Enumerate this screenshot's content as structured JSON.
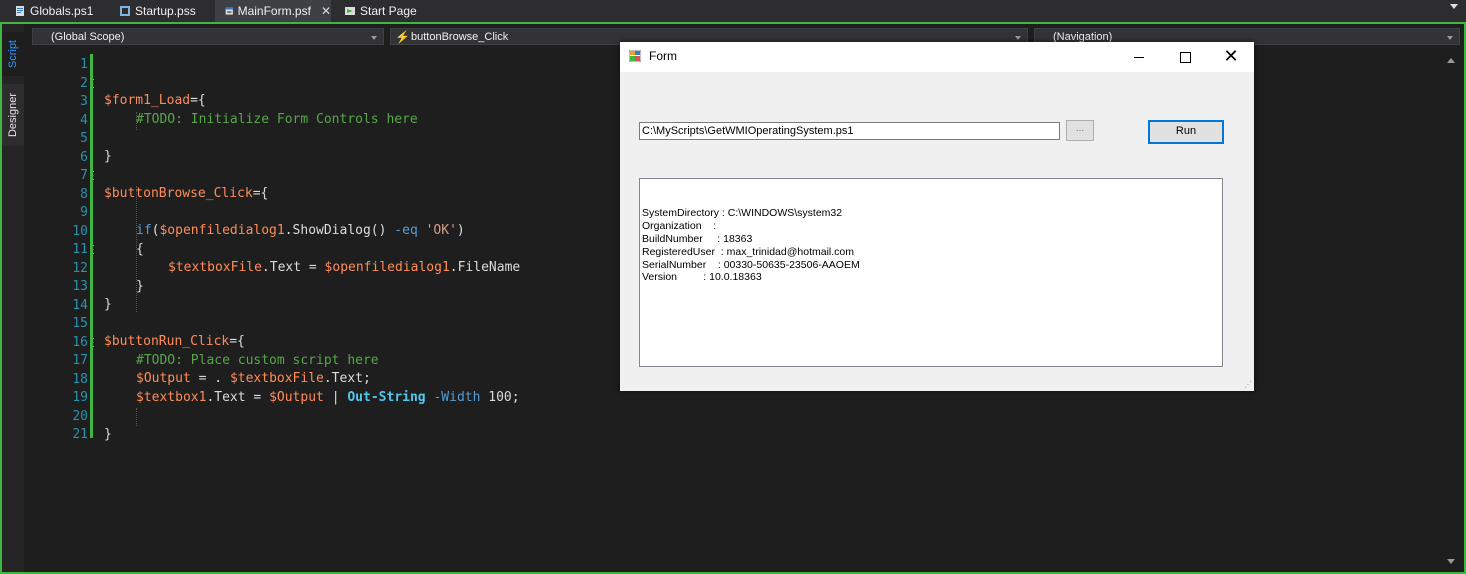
{
  "tabs": [
    {
      "label": "Globals.ps1",
      "icon": "script-file-icon",
      "active": false
    },
    {
      "label": "Startup.pss",
      "icon": "project-file-icon",
      "active": false
    },
    {
      "label": "MainForm.psf",
      "icon": "form-file-icon",
      "active": true
    },
    {
      "label": "Start Page",
      "icon": "start-page-icon",
      "active": false
    }
  ],
  "tab_close_glyph": "✕",
  "side_tabs": {
    "script": "Script",
    "designer": "Designer"
  },
  "dropdowns": {
    "scope": "(Global Scope)",
    "function": "buttonBrowse_Click",
    "function_icon": "lightning-icon",
    "navigation": "(Navigation)"
  },
  "line_numbers": [
    "1",
    "2",
    "3",
    "4",
    "5",
    "6",
    "7",
    "8",
    "9",
    "10",
    "11",
    "12",
    "13",
    "14",
    "15",
    "16",
    "17",
    "18",
    "19",
    "20",
    "21"
  ],
  "code": {
    "l2_var": "$form1_Load",
    "l2_rest": "={",
    "l3": "#TODO: Initialize Form Controls here",
    "l5": "}",
    "l7_var": "$buttonBrowse_Click",
    "l7_rest": "={",
    "l9_kw": "if",
    "l9_p1": "(",
    "l9_var": "$openfiledialog1",
    "l9_p2": ".ShowDialog() ",
    "l9_op": "-eq",
    "l9_sp": " ",
    "l9_str": "'OK'",
    "l9_p3": ")",
    "l10": "{",
    "l11_var1": "$textboxFile",
    "l11_p1": ".Text = ",
    "l11_var2": "$openfiledialog1",
    "l11_p2": ".FileName",
    "l12": "}",
    "l13": "}",
    "l15_var": "$buttonRun_Click",
    "l15_rest": "={",
    "l16": "#TODO: Place custom script here",
    "l17_var": "$Output",
    "l17_p1": " = . ",
    "l17_var2": "$textboxFile",
    "l17_p2": ".Text;",
    "l18_var": "$textbox1",
    "l18_p1": ".Text = ",
    "l18_var2": "$Output",
    "l18_pipe": " | ",
    "l18_cmd": "Out-String",
    "l18_sp": " ",
    "l18_param": "-Width",
    "l18_num": " 100;",
    "l20": "}"
  },
  "form": {
    "title": "Form",
    "minimize_icon": "minimize-icon",
    "maximize_icon": "maximize-icon",
    "close_glyph": "✕",
    "path_value": "C:\\MyScripts\\GetWMIOperatingSystem.ps1",
    "browse_label": "...",
    "run_label": "Run",
    "output_lines": [
      "SystemDirectory : C:\\WINDOWS\\system32",
      "Organization    :",
      "BuildNumber     : 18363",
      "RegisteredUser  : max_trinidad@hotmail.com",
      "SerialNumber    : 00330-50635-23506-AAOEM",
      "Version         : 10.0.18363"
    ]
  },
  "colors": {
    "accent_green": "#3fb63f",
    "editor_bg": "#1e1e1e",
    "variable": "#ff8c5a",
    "comment": "#57a64a",
    "keyword": "#569cd6",
    "line_number": "#2b91af"
  }
}
